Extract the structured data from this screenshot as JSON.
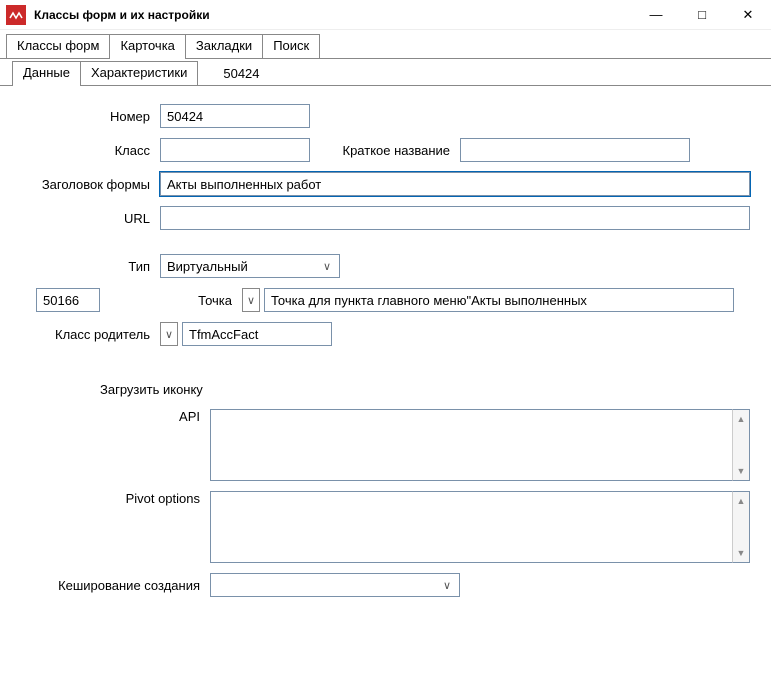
{
  "window": {
    "title": "Классы форм и их настройки"
  },
  "tabs_outer": [
    "Классы форм",
    "Карточка",
    "Закладки",
    "Поиск"
  ],
  "tabs_outer_active": 1,
  "tabs_inner": [
    "Данные",
    "Характеристики"
  ],
  "tabs_inner_active": 0,
  "tabs_inner_extra": "50424",
  "labels": {
    "number": "Номер",
    "klass": "Класс",
    "short_name": "Краткое название",
    "form_title": "Заголовок формы",
    "url": "URL",
    "type": "Тип",
    "point": "Точка",
    "parent_class": "Класс родитель",
    "load_icon": "Загрузить иконку",
    "api": "API",
    "pivot": "Pivot options",
    "cache": "Кеширование создания"
  },
  "fields": {
    "number": "50424",
    "klass": "",
    "short_name": "",
    "form_title": "Акты выполненных работ",
    "url": "",
    "type": "Виртуальный",
    "left_code": "50166",
    "point": "Точка для пункта главного меню\"Акты выполненных",
    "parent_class": "TfmAccFact",
    "api": "",
    "pivot": "",
    "cache": ""
  }
}
